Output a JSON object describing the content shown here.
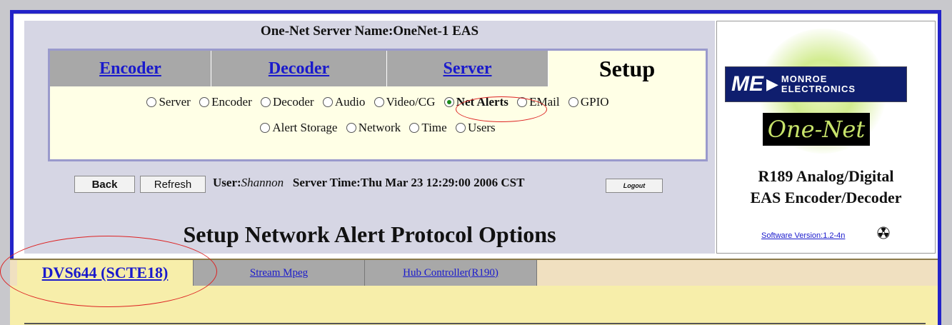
{
  "server_name": "One-Net Server Name:OneNet-1 EAS",
  "tabs": [
    {
      "label": "Encoder"
    },
    {
      "label": "Decoder"
    },
    {
      "label": "Server"
    },
    {
      "label": "Setup"
    }
  ],
  "radio_row1": [
    "Server",
    "Encoder",
    "Decoder",
    "Audio",
    "Video/CG",
    "Net Alerts",
    "EMail",
    "GPIO"
  ],
  "radio_row2": [
    "Alert Storage",
    "Network",
    "Time",
    "Users"
  ],
  "selected_radio": "Net Alerts",
  "buttons": {
    "back": "Back",
    "refresh": "Refresh",
    "logout": "Logout"
  },
  "user": {
    "label": "User:",
    "name": "Shannon",
    "server_time": "Server Time:Thu Mar 23 12:29:00 2006 CST"
  },
  "page_heading": "Setup Network Alert Protocol Options",
  "logo": {
    "mark": "ME",
    "line1": "MONROE",
    "line2": "ELECTRONICS",
    "product_logo": "One-Net"
  },
  "product": {
    "line1": "R189 Analog/Digital",
    "line2": "EAS Encoder/Decoder"
  },
  "software_version": "Software Version:1.2-4n",
  "subtabs": [
    {
      "label": "DVS644 (SCTE18)"
    },
    {
      "label": "Stream Mpeg"
    },
    {
      "label": "Hub Controller(R190)"
    }
  ],
  "colors": {
    "link": "#1a1acc",
    "frame_blue": "#2323c9",
    "panel": "#d6d6e4",
    "tab_gray": "#a8a8a8",
    "highlight_red": "#dd2222"
  }
}
